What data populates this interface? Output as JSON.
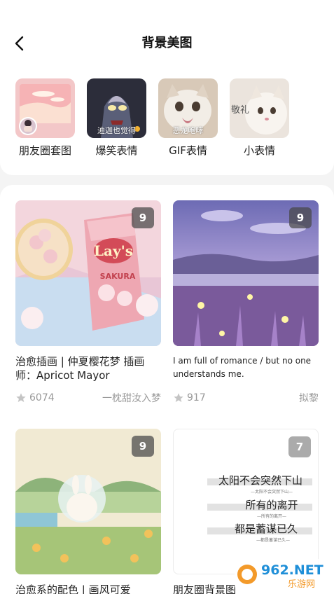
{
  "header": {
    "title": "背景美图"
  },
  "categories": [
    {
      "label": "朋友圈套图",
      "caption": ""
    },
    {
      "label": "爆笑表情",
      "caption": "迪迦也觉得"
    },
    {
      "label": "GIF表情",
      "caption": "恶龙咆哮"
    },
    {
      "label": "小表情",
      "caption": "敬礼"
    }
  ],
  "cards": [
    {
      "title": "治愈插画 | 仲夏樱花梦  插画师：Apricot Mayor",
      "count": "9",
      "likes": "6074",
      "author": "一枕甜汝入梦",
      "image_text": "Lay's",
      "image_sub": "SAKURA"
    },
    {
      "title": "I am full of romance / but no one understands me.",
      "count": "9",
      "likes": "917",
      "author": "拟黎"
    },
    {
      "title": "治愈系的配色 | 画风可爱",
      "count": "9"
    },
    {
      "title": "朋友圈背景图",
      "count": "7",
      "image_lines": [
        "太阳不会突然下山",
        "所有的离开",
        "都是蓄谋已久"
      ],
      "image_sublines": [
        "—太阳不会突然下山—",
        "—所有的离开—",
        "—都是蓄谋已久—"
      ]
    }
  ],
  "watermark": {
    "main": "962.NET",
    "sub": "乐游网"
  },
  "colors": {
    "accent": "#111111",
    "meta": "#999999",
    "badge": "#464646"
  }
}
